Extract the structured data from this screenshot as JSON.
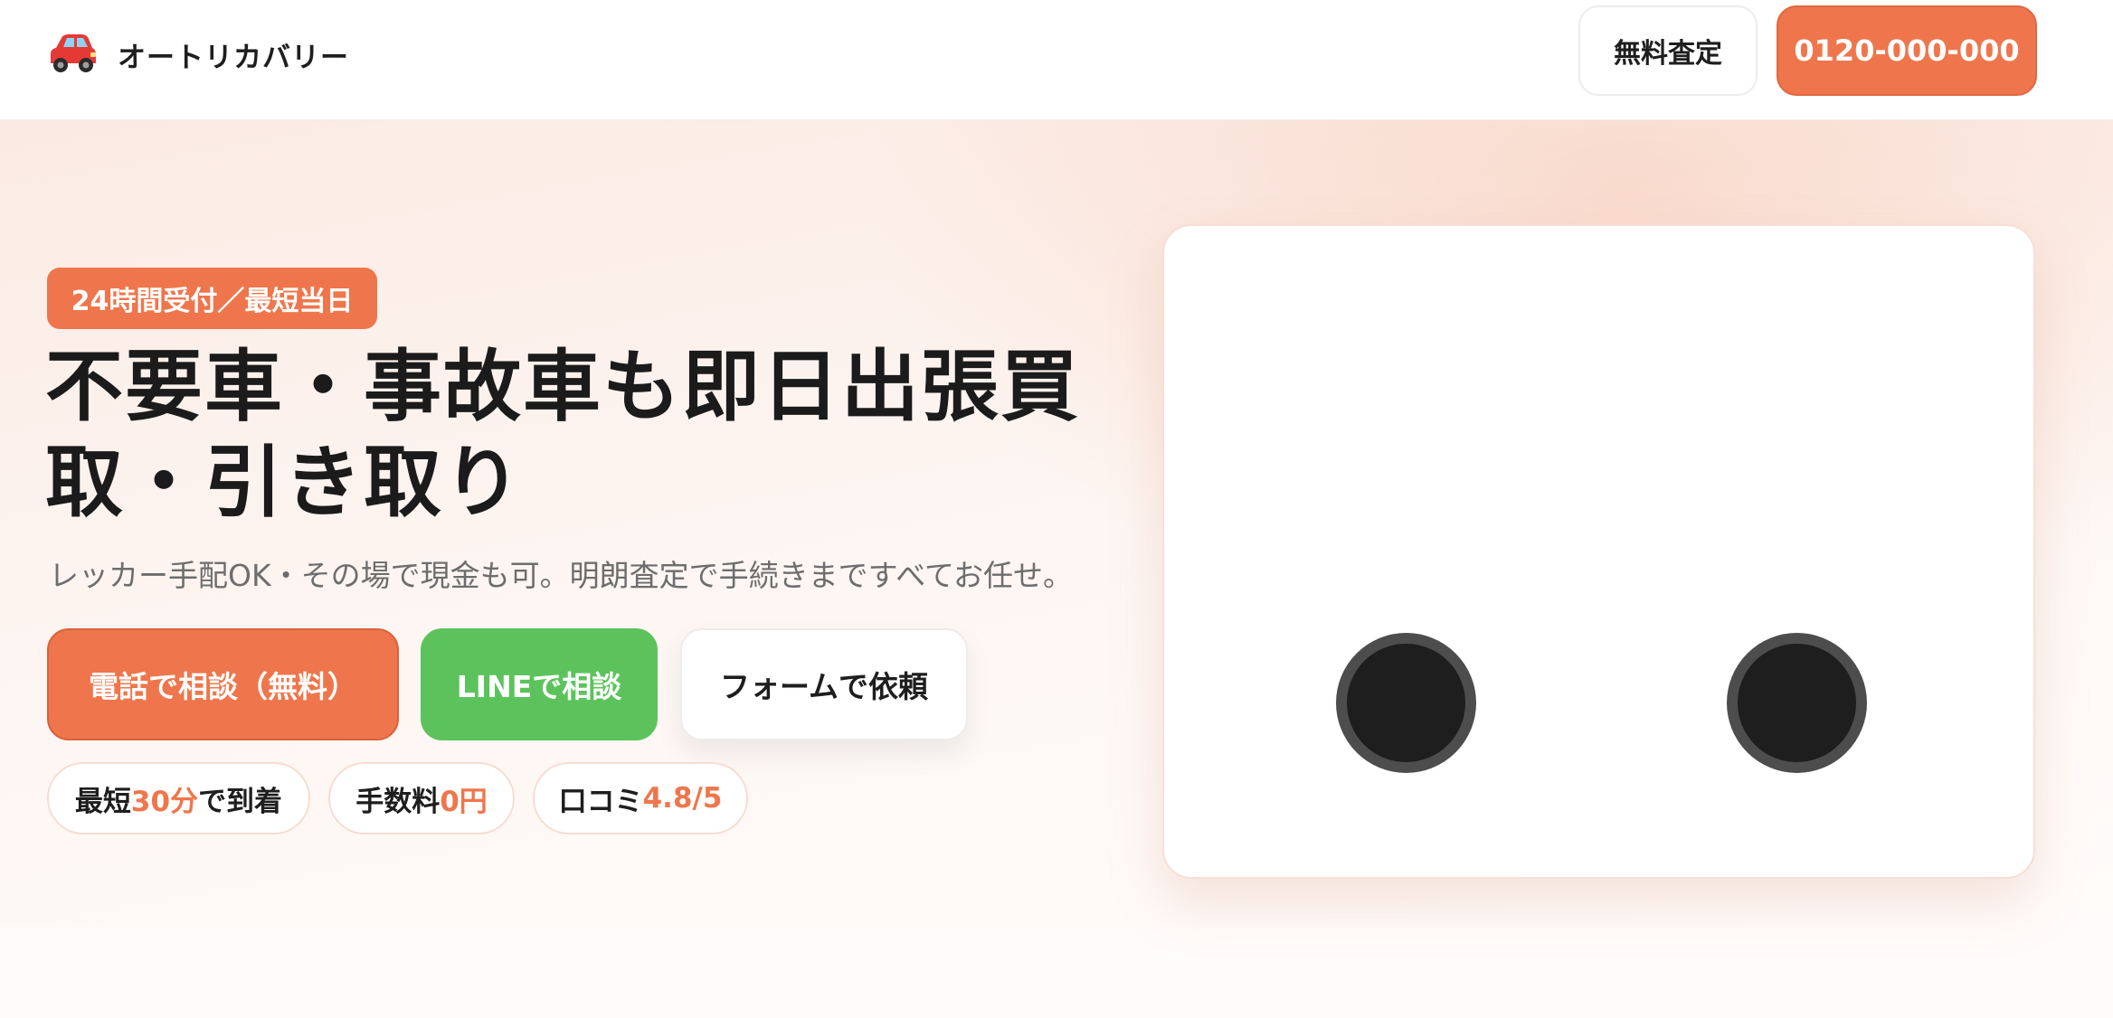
{
  "header": {
    "logo_icon": "red-car-icon",
    "brand": "オートリカバリー",
    "assess_button": "無料査定",
    "phone_button": "0120-000-000"
  },
  "hero": {
    "badge": "24時間受付／最短当日",
    "headline": "不要車・事故車も即日出張買取・引き取り",
    "subtext": "レッカー手配OK・その場で現金も可。明朗査定で手続きまですべてお任せ。",
    "cta": {
      "call": "電話で相談（無料）",
      "line": "LINEで相談",
      "form": "フォームで依頼"
    },
    "chips": [
      {
        "prefix": "最短",
        "highlight": "30分",
        "suffix": "で到着"
      },
      {
        "prefix": "手数料",
        "highlight": "0円",
        "suffix": ""
      },
      {
        "prefix": "口コミ",
        "highlight": "4.8/5",
        "suffix": ""
      }
    ]
  },
  "illustration": {
    "type": "car-illustration",
    "wheel_color": "#1e1e1e",
    "rim_color": "#4d4d4d"
  },
  "colors": {
    "accent": "#ef764c",
    "line_green": "#5cc35c",
    "text": "#1e1e1e",
    "muted": "#6d6d6d"
  }
}
